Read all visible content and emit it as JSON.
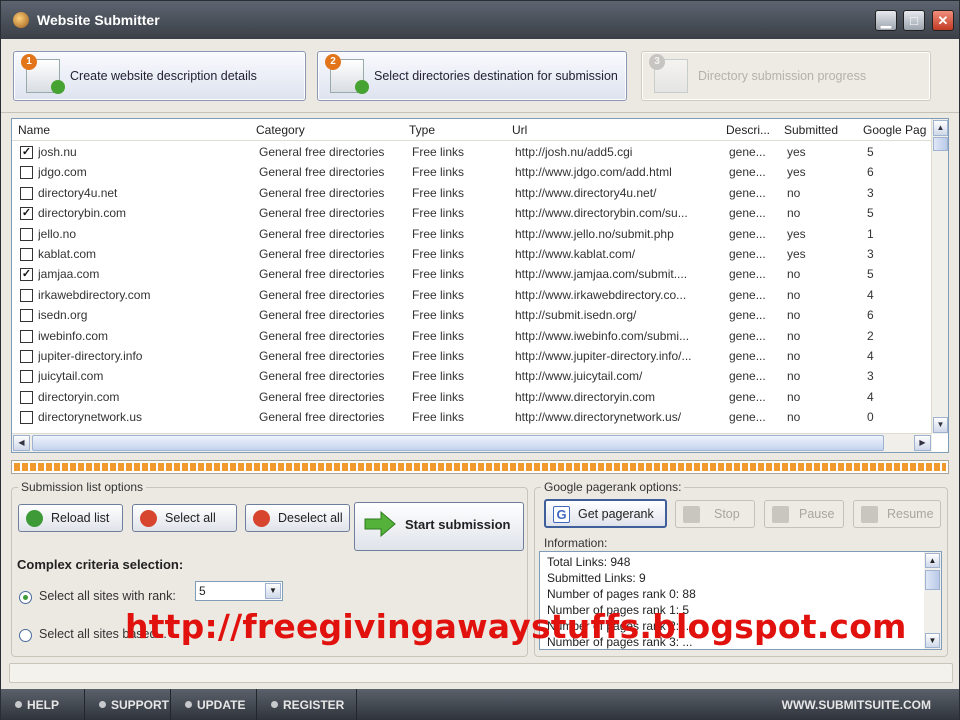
{
  "window": {
    "title": "Website Submitter"
  },
  "steps": [
    {
      "number": "1",
      "label": "Create website description details"
    },
    {
      "number": "2",
      "label": "Select directories destination for submission"
    },
    {
      "number": "3",
      "label": "Directory submission progress"
    }
  ],
  "table": {
    "columns": [
      "Name",
      "Category",
      "Type",
      "Url",
      "Descri...",
      "Submitted",
      "Google Pag"
    ],
    "rows": [
      {
        "checked": true,
        "name": "josh.nu",
        "category": "General free directories",
        "type": "Free links",
        "url": "http://josh.nu/add5.cgi",
        "desc": "gene...",
        "submitted": "yes",
        "rank": "5"
      },
      {
        "checked": false,
        "name": "jdgo.com",
        "category": "General free directories",
        "type": "Free links",
        "url": "http://www.jdgo.com/add.html",
        "desc": "gene...",
        "submitted": "yes",
        "rank": "6"
      },
      {
        "checked": false,
        "name": "directory4u.net",
        "category": "General free directories",
        "type": "Free links",
        "url": "http://www.directory4u.net/",
        "desc": "gene...",
        "submitted": "no",
        "rank": "3"
      },
      {
        "checked": true,
        "name": "directorybin.com",
        "category": "General free directories",
        "type": "Free links",
        "url": "http://www.directorybin.com/su...",
        "desc": "gene...",
        "submitted": "no",
        "rank": "5"
      },
      {
        "checked": false,
        "name": "jello.no",
        "category": "General free directories",
        "type": "Free links",
        "url": "http://www.jello.no/submit.php",
        "desc": "gene...",
        "submitted": "yes",
        "rank": "1"
      },
      {
        "checked": false,
        "name": "kablat.com",
        "category": "General free directories",
        "type": "Free links",
        "url": "http://www.kablat.com/",
        "desc": "gene...",
        "submitted": "yes",
        "rank": "3"
      },
      {
        "checked": true,
        "name": "jamjaa.com",
        "category": "General free directories",
        "type": "Free links",
        "url": "http://www.jamjaa.com/submit....",
        "desc": "gene...",
        "submitted": "no",
        "rank": "5"
      },
      {
        "checked": false,
        "name": "irkawebdirectory.com",
        "category": "General free directories",
        "type": "Free links",
        "url": "http://www.irkawebdirectory.co...",
        "desc": "gene...",
        "submitted": "no",
        "rank": "4"
      },
      {
        "checked": false,
        "name": "isedn.org",
        "category": "General free directories",
        "type": "Free links",
        "url": "http://submit.isedn.org/",
        "desc": "gene...",
        "submitted": "no",
        "rank": "6"
      },
      {
        "checked": false,
        "name": "iwebinfo.com",
        "category": "General free directories",
        "type": "Free links",
        "url": "http://www.iwebinfo.com/submi...",
        "desc": "gene...",
        "submitted": "no",
        "rank": "2"
      },
      {
        "checked": false,
        "name": "jupiter-directory.info",
        "category": "General free directories",
        "type": "Free links",
        "url": "http://www.jupiter-directory.info/...",
        "desc": "gene...",
        "submitted": "no",
        "rank": "4"
      },
      {
        "checked": false,
        "name": "juicytail.com",
        "category": "General free directories",
        "type": "Free links",
        "url": "http://www.juicytail.com/",
        "desc": "gene...",
        "submitted": "no",
        "rank": "3"
      },
      {
        "checked": false,
        "name": "directoryin.com",
        "category": "General free directories",
        "type": "Free links",
        "url": "http://www.directoryin.com",
        "desc": "gene...",
        "submitted": "no",
        "rank": "4"
      },
      {
        "checked": false,
        "name": "directorynetwork.us",
        "category": "General free directories",
        "type": "Free links",
        "url": "http://www.directorynetwork.us/",
        "desc": "gene...",
        "submitted": "no",
        "rank": "0"
      }
    ]
  },
  "submission_options": {
    "title": "Submission list options",
    "reload": "Reload list",
    "select_all": "Select all",
    "deselect_all": "Deselect all",
    "start": "Start submission",
    "complex_title": "Complex criteria selection:",
    "radio1": "Select all sites with rank:",
    "rank_value": "5",
    "radio2": "Select all sites based..."
  },
  "pagerank_options": {
    "title": "Google pagerank options:",
    "get": "Get pagerank",
    "stop": "Stop",
    "pause": "Pause",
    "resume": "Resume",
    "info_title": "Information:",
    "info_lines": [
      "Total Links:     948",
      "Submitted Links: 9",
      "Number of pages rank 0: 88",
      "Number of pages rank 1: 5",
      "Number of pages rank 2: ...",
      "Number of pages rank 3: ..."
    ]
  },
  "footer": {
    "help": "HELP",
    "support": "SUPPORT",
    "update": "UPDATE",
    "register": "REGISTER",
    "site": "WWW.SUBMITSUITE.COM"
  },
  "watermark": "http://freegivingawaystuffs.blogspot.com",
  "colors": {
    "accent_orange": "#f09a2e",
    "watermark_red": "#e1110d",
    "titlebar": "#3a3f47"
  }
}
